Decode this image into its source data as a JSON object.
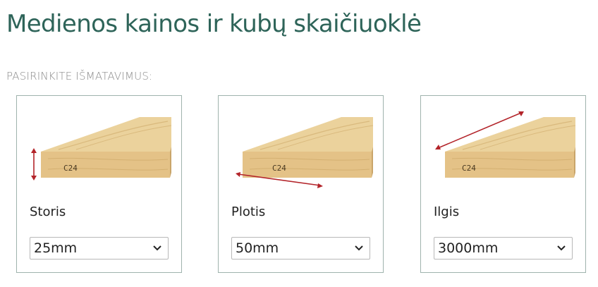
{
  "page": {
    "title": "Medienos kainos ir kubų skaičiuoklė",
    "subtitle": "PASIRINKITE IŠMATAVIMUS:"
  },
  "cards": [
    {
      "label": "Storis",
      "selected": "25mm",
      "stamp": "C24",
      "icon": "plank-thickness-image"
    },
    {
      "label": "Plotis",
      "selected": "50mm",
      "stamp": "C24",
      "icon": "plank-width-image"
    },
    {
      "label": "Ilgis",
      "selected": "3000mm",
      "stamp": "C24",
      "icon": "plank-length-image"
    }
  ],
  "colors": {
    "title": "#2e6459",
    "card_border": "#9fb3ad",
    "wood_top": "#ecd29a",
    "wood_front": "#e6c384",
    "measure_arrow": "#b3242a"
  }
}
